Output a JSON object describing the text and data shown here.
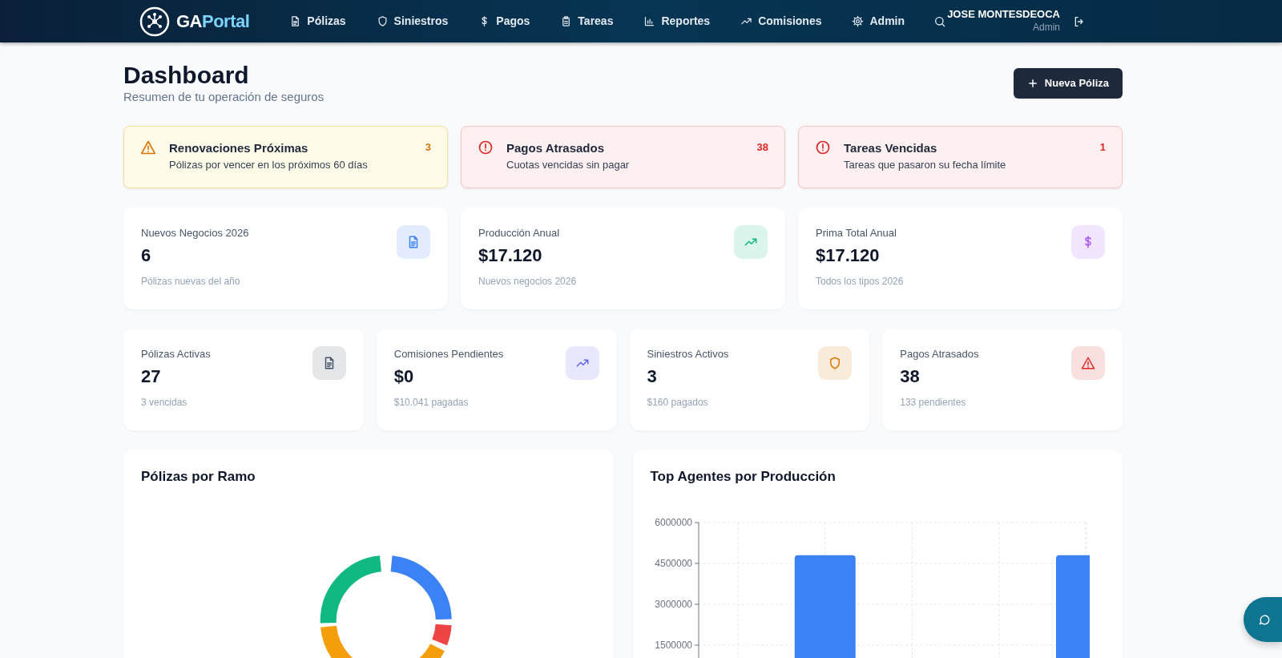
{
  "navbar": {
    "brand_left": "GA",
    "brand_right": "Portal",
    "items": [
      {
        "label": "Pólizas",
        "selected": false
      },
      {
        "label": "Siniestros",
        "selected": false
      },
      {
        "label": "Pagos",
        "selected": false
      },
      {
        "label": "Tareas",
        "selected": false
      },
      {
        "label": "Reportes",
        "selected": false
      },
      {
        "label": "Comisiones",
        "selected": false
      },
      {
        "label": "Admin",
        "selected": false
      }
    ],
    "user": {
      "name": "JOSE MONTESDEOCA",
      "role": "Admin"
    }
  },
  "header": {
    "title": "Dashboard",
    "subtitle": "Resumen de tu operación de seguros",
    "button": "Nueva Póliza"
  },
  "alerts": [
    {
      "kind": "warning",
      "title": "Renovaciones Próximas",
      "text": "Pólizas por vencer en los próximos 60 días",
      "count": "3"
    },
    {
      "kind": "danger",
      "title": "Pagos Atrasados",
      "text": "Cuotas vencidas sin pagar",
      "count": "38"
    },
    {
      "kind": "danger",
      "title": "Tareas Vencidas",
      "text": "Tareas que pasaron su fecha límite",
      "count": "1"
    }
  ],
  "stats_top": [
    {
      "label": "Nuevos Negocios 2026",
      "value": "6",
      "note": "Pólizas nuevas del año",
      "color": "#3b82f6"
    },
    {
      "label": "Producción Anual",
      "value": "$17.120",
      "note": "Nuevos negocios 2026",
      "color": "#10b981"
    },
    {
      "label": "Prima Total Anual",
      "value": "$17.120",
      "note": "Todos los tipos 2026",
      "color": "#a855f7"
    }
  ],
  "stats_bottom": [
    {
      "label": "Pólizas Activas",
      "value": "27",
      "note": "3 vencidas",
      "color": "#475569"
    },
    {
      "label": "Comisiones Pendientes",
      "value": "$0",
      "note": "$10.041 pagadas",
      "color": "#6366f1"
    },
    {
      "label": "Siniestros Activos",
      "value": "3",
      "note": "$160 pagados",
      "color": "#d97706"
    },
    {
      "label": "Pagos Atrasados",
      "value": "38",
      "note": "133 pendientes",
      "color": "#dc2626"
    }
  ],
  "donut_panel": {
    "title": "Pólizas por Ramo"
  },
  "bar_panel": {
    "title": "Top Agentes por Producción",
    "chart_data": {
      "type": "bar",
      "values": [
        0,
        4800000,
        0,
        0,
        4800000
      ],
      "ylim": [
        0,
        6000000
      ],
      "grid": true,
      "yticks": [
        1500000,
        3000000,
        4500000,
        6000000
      ]
    }
  }
}
